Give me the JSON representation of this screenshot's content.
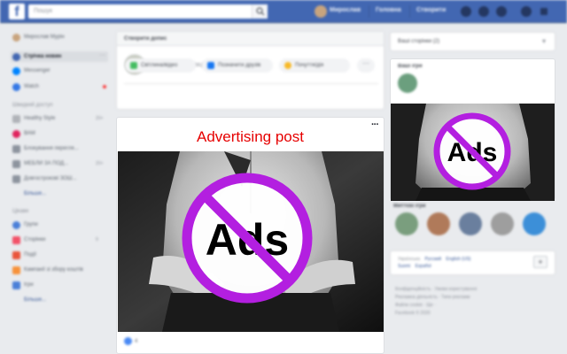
{
  "topbar": {
    "logo": "f",
    "search_placeholder": "Пошук",
    "username": "Мирослав",
    "links": [
      "Головна",
      "Створити"
    ]
  },
  "sidebar": {
    "profile_name": "Мирослав Мурін",
    "items": [
      {
        "label": "Стрічка новин",
        "color": "#4267b2",
        "active": true
      },
      {
        "label": "Messenger",
        "color": "#0084ff"
      },
      {
        "label": "Watch",
        "color": "#3578e5",
        "dot": true
      }
    ],
    "shortcuts_heading": "Швидкий доступ",
    "shortcuts": [
      {
        "label": "Healthy Style",
        "color": "#b0b3b8",
        "count": "20+"
      },
      {
        "label": "ВАМ",
        "color": "#e0245e"
      },
      {
        "label": "Блокування перегля...",
        "color": "#8d949e"
      },
      {
        "label": "МЕБЛИ ЗА ПОД...",
        "color": "#8d949e",
        "count": "20+"
      },
      {
        "label": "Довгострокові ЗОШ...",
        "color": "#8d949e"
      }
    ],
    "shortcuts_more": "Більше...",
    "explore_heading": "Цікаве",
    "explore": [
      {
        "label": "Групи",
        "color": "#4b7fd8"
      },
      {
        "label": "Сторінки",
        "color": "#f25268",
        "count": "9"
      },
      {
        "label": "Події",
        "color": "#e9553b"
      },
      {
        "label": "Кампанії зі збору коштів",
        "color": "#f7923a"
      },
      {
        "label": "Ігри",
        "color": "#4b7fd8"
      }
    ],
    "explore_more": "Більше..."
  },
  "composer": {
    "header": "Створити допис",
    "placeholder": "Що у вас на думці, Мирослав?",
    "actions": [
      "Світлина/відео",
      "Позначити друзів",
      "Почуття/дія"
    ],
    "more_label": "···"
  },
  "post": {
    "title": "Advertising post",
    "menu_label": "···",
    "sign_text": "Ads",
    "reaction_count": "4"
  },
  "right": {
    "pages_dropdown": "Ваші сторінки (2)",
    "games_title": "Ваші ігри",
    "sign_text": "Ads",
    "instant_games_title": "Миттєві ігри",
    "instant_game_colors": [
      "#7a9e7e",
      "#b07a5a",
      "#6a7f9e",
      "#9e9e9e",
      "#3c8fd8"
    ],
    "languages": {
      "current": "Українська",
      "others": [
        "Русский",
        "English (US)",
        "Suomi",
        "Español"
      ]
    },
    "plus_label": "+",
    "footer": [
      "Конфіденційність · Умови користування",
      "Рекламна діяльність · Типи реклами",
      "Файли cookie · Ще ·",
      "Facebook © 2020"
    ]
  },
  "colors": {
    "brand": "#4267b2",
    "ad_title": "#e60000",
    "no_sign": "#b31fe0"
  }
}
